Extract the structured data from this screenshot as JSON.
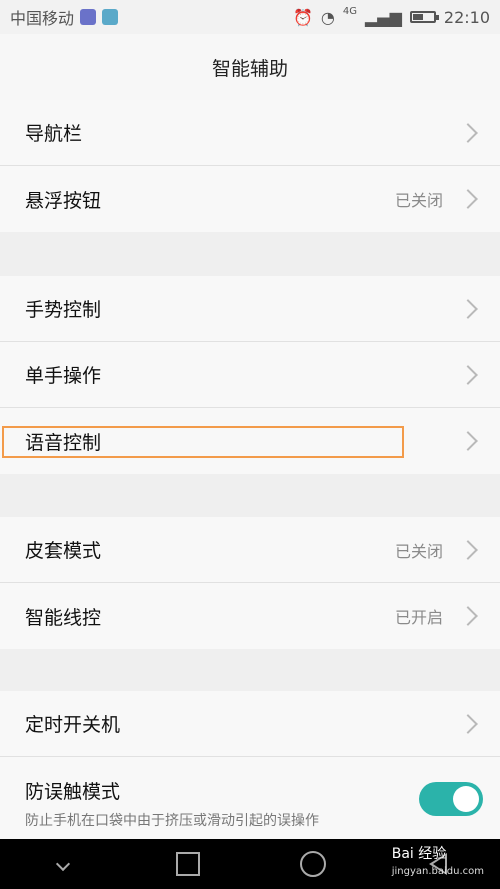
{
  "status": {
    "carrier": "中国移动",
    "network": "4G",
    "time": "22:10"
  },
  "header": {
    "title": "智能辅助"
  },
  "groups": [
    {
      "items": [
        {
          "label": "导航栏",
          "value": ""
        },
        {
          "label": "悬浮按钮",
          "value": "已关闭"
        }
      ]
    },
    {
      "items": [
        {
          "label": "手势控制",
          "value": ""
        },
        {
          "label": "单手操作",
          "value": ""
        },
        {
          "label": "语音控制",
          "value": ""
        }
      ]
    },
    {
      "items": [
        {
          "label": "皮套模式",
          "value": "已关闭"
        },
        {
          "label": "智能线控",
          "value": "已开启"
        }
      ]
    },
    {
      "items": [
        {
          "label": "定时开关机",
          "value": ""
        }
      ]
    }
  ],
  "toggle_item": {
    "title": "防误触模式",
    "description": "防止手机在口袋中由于挤压或滑动引起的误操作",
    "enabled": true
  },
  "watermark": {
    "brand": "Bai 经验",
    "site": "jingyan.baidu.com"
  },
  "icons": {
    "chevron": "chevron-right-icon",
    "back": "back-triangle-icon",
    "home": "home-circle-icon",
    "recent": "recent-square-icon",
    "collapse": "down-arrow-icon"
  },
  "colors": {
    "toggle": "#2bb3aa",
    "highlight": "#f39b4a"
  }
}
